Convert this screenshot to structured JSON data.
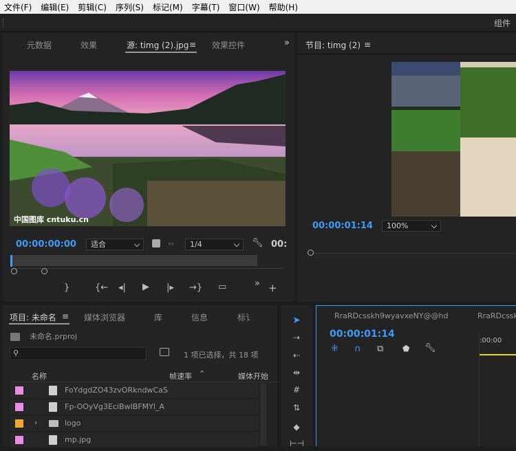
{
  "menu": [
    "文件(F)",
    "编辑(E)",
    "剪辑(C)",
    "序列(S)",
    "标记(M)",
    "字幕(T)",
    "窗口(W)",
    "帮助(H)"
  ],
  "workspace_label": "组件",
  "source_panel": {
    "tabs": [
      "元数据",
      "效果",
      "源: timg (2).jpg",
      "效果控件"
    ],
    "timecode": "00:00:00:00",
    "fit": "适合",
    "resolution": "1/4",
    "timecode_right": "00:",
    "watermark": "中国图库 cntuku.cn"
  },
  "program_panel": {
    "title": "节目: timg (2)",
    "timecode": "00:00:01:14",
    "zoom": "100%"
  },
  "project_panel": {
    "tabs": [
      "项目: 未命名",
      "媒体浏览器",
      "库",
      "信息",
      "标讠"
    ],
    "project_file": "未命名.prproj",
    "selection_info": "1 项已选择，共 18 项",
    "columns": [
      "名称",
      "帧速率",
      "媒体开始"
    ],
    "items": [
      {
        "name": "FoYdgdZO43zvORkndwCaS",
        "color": "#e88ee0",
        "type": "file"
      },
      {
        "name": "Fp-OOyVg3EciBwIBFMYl_A",
        "color": "#e88ee0",
        "type": "file"
      },
      {
        "name": "logo",
        "color": "#f0a830",
        "type": "folder"
      },
      {
        "name": "mp.jpg",
        "color": "#e88ee0",
        "type": "file"
      }
    ]
  },
  "timeline_panel": {
    "sequence_name": "RraRDcsskh9wyavxeNY@@hd",
    "sequence_name_2": "RraRDcsskh",
    "timecode": "00:00:01:14",
    "ruler_label": ":00:00"
  }
}
